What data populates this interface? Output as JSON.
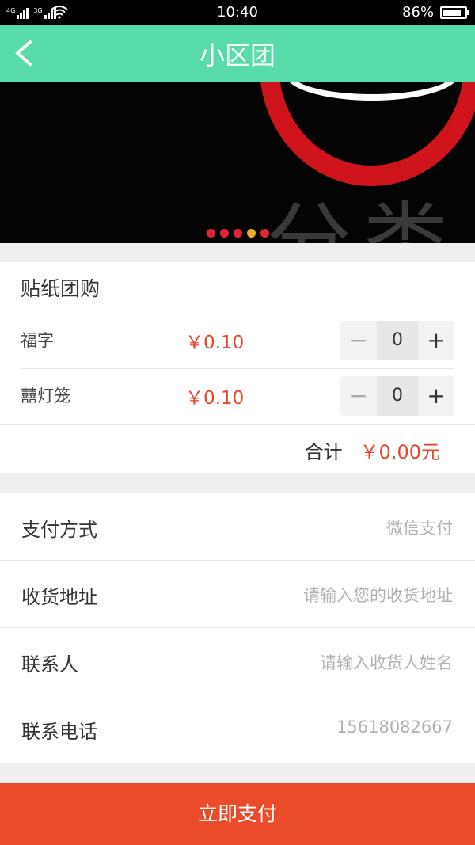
{
  "status_bar": {
    "network_1": "4G",
    "network_2": "3G",
    "time": "10:40",
    "battery_text": "86%",
    "battery_level": 0.86
  },
  "header": {
    "back_icon": "chevron-left-icon",
    "title": "小区团"
  },
  "banner": {
    "text": "分类",
    "dots_count": 5,
    "active_dot": 4
  },
  "sticker_group": {
    "title": "贴纸团购",
    "items": [
      {
        "name": "福字",
        "price": "￥0.10",
        "minus": "−",
        "qty": "0",
        "plus": "+"
      },
      {
        "name": "囍灯笼",
        "price": "￥0.10",
        "minus": "−",
        "qty": "0",
        "plus": "+"
      }
    ],
    "total_label": "合计",
    "total_amount": "￥0.00元"
  },
  "form": {
    "rows": [
      {
        "label": "支付方式",
        "value": "微信支付"
      },
      {
        "label": "收货地址",
        "value": "请输入您的收货地址"
      },
      {
        "label": "联系人",
        "value": "请输入收货人姓名"
      },
      {
        "label": "联系电话",
        "value": "15618082667"
      }
    ]
  },
  "pay_button": "立即支付",
  "colors": {
    "header_bg": "#57dba8",
    "price_red": "#e8432b",
    "pay_button_bg": "#ea4c2b",
    "dot_red": "#e2243a",
    "dot_active": "#f0a826"
  }
}
